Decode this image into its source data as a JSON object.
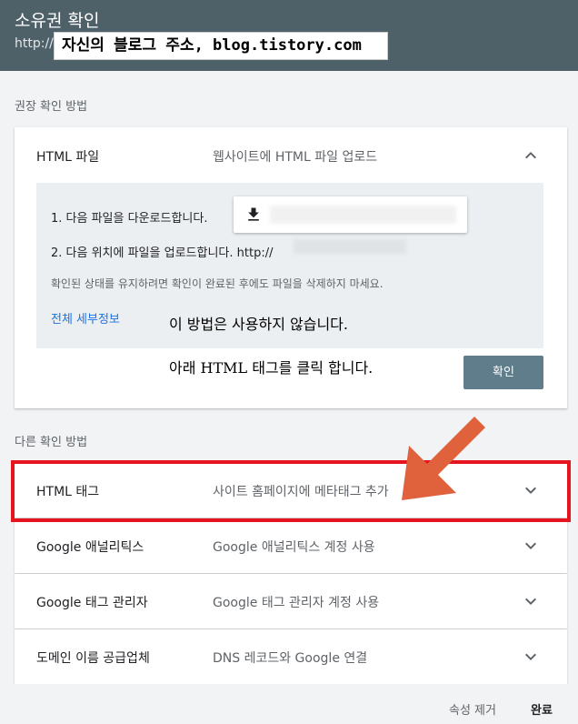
{
  "header": {
    "title": "소유권 확인",
    "url_prefix": "http://"
  },
  "annotation": {
    "overlay_text": "자신의 블로그 주소, blog.tistory.com",
    "note_line1": "이 방법은 사용하지 않습니다.",
    "note_line2": "아래 HTML 태그를 클릭 합니다."
  },
  "recommended": {
    "label": "권장 확인 방법",
    "method": {
      "title": "HTML 파일",
      "description": "웹사이트에 HTML 파일 업로드",
      "step1": "1. 다음 파일을 다운로드합니다.",
      "step2": "2. 다음 위치에 파일을 업로드합니다. http://",
      "note": "확인된 상태를 유지하려면 확인이 완료된 후에도 파일을 삭제하지 마세요.",
      "details_link": "전체 세부정보",
      "confirm_button": "확인"
    }
  },
  "other": {
    "label": "다른 확인 방법",
    "methods": [
      {
        "title": "HTML 태그",
        "description": "사이트 홈페이지에 메타태그 추가"
      },
      {
        "title": "Google 애널리틱스",
        "description": "Google 애널리틱스 계정 사용"
      },
      {
        "title": "Google 태그 관리자",
        "description": "Google 태그 관리자 계정 사용"
      },
      {
        "title": "도메인 이름 공급업체",
        "description": "DNS 레코드와 Google 연결"
      }
    ]
  },
  "footer": {
    "remove_label": "속성 제거",
    "done_label": "완료"
  },
  "icons": {
    "download": "download-icon",
    "expand": "chevron-down-icon",
    "collapse": "chevron-up-icon"
  },
  "colors": {
    "header_bg": "#4e6068",
    "link": "#1a73e8",
    "highlight": "#e6141e",
    "arrow": "#e0623d"
  }
}
